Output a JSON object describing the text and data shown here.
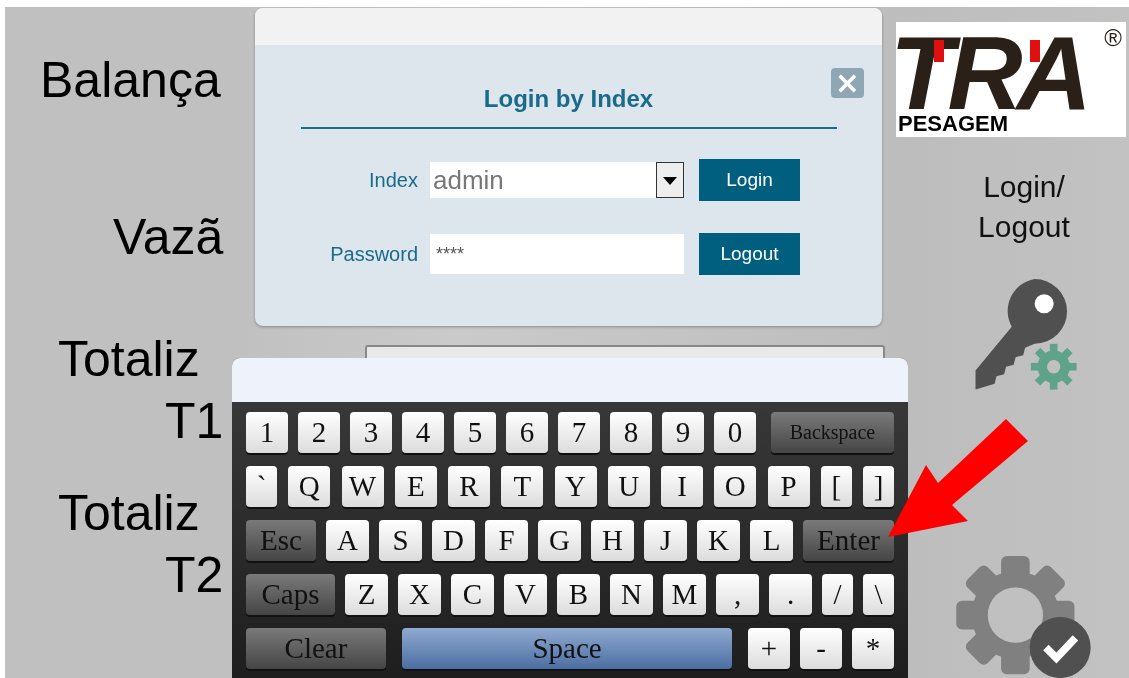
{
  "labels": [
    "Balança",
    "Vazã",
    "Totaliz",
    "T1",
    "Totaliz",
    "T2"
  ],
  "logo": {
    "name": "TRA",
    "mark": "®",
    "tagline": "PESAGEM"
  },
  "login_logout_label": "Login/ Logout",
  "dialog": {
    "title": "Login by Index",
    "close": "×",
    "index_label": "Index",
    "index_value": "admin",
    "password_label": "Password",
    "password_value": "****",
    "buttons": [
      "Login",
      "Logout"
    ]
  },
  "keyboard": {
    "rows": [
      {
        "keys": [
          {
            "label": "1",
            "kind": "char"
          },
          {
            "label": "2",
            "kind": "char"
          },
          {
            "label": "3",
            "kind": "char"
          },
          {
            "label": "4",
            "kind": "char"
          },
          {
            "label": "5",
            "kind": "char"
          },
          {
            "label": "6",
            "kind": "char"
          },
          {
            "label": "7",
            "kind": "char"
          },
          {
            "label": "8",
            "kind": "char"
          },
          {
            "label": "9",
            "kind": "char"
          },
          {
            "label": "0",
            "kind": "char"
          },
          {
            "label": "Backspace",
            "kind": "function"
          }
        ]
      },
      {
        "keys": [
          {
            "label": "`",
            "kind": "symbol"
          },
          {
            "label": "Q",
            "kind": "char"
          },
          {
            "label": "W",
            "kind": "char"
          },
          {
            "label": "E",
            "kind": "char"
          },
          {
            "label": "R",
            "kind": "char"
          },
          {
            "label": "T",
            "kind": "char"
          },
          {
            "label": "Y",
            "kind": "char"
          },
          {
            "label": "U",
            "kind": "char"
          },
          {
            "label": "I",
            "kind": "char"
          },
          {
            "label": "O",
            "kind": "char"
          },
          {
            "label": "P",
            "kind": "char"
          },
          {
            "label": "[",
            "kind": "symbol"
          },
          {
            "label": "]",
            "kind": "symbol"
          }
        ]
      },
      {
        "keys": [
          {
            "label": "Esc",
            "kind": "function"
          },
          {
            "label": "A",
            "kind": "char"
          },
          {
            "label": "S",
            "kind": "char"
          },
          {
            "label": "D",
            "kind": "char"
          },
          {
            "label": "F",
            "kind": "char"
          },
          {
            "label": "G",
            "kind": "char"
          },
          {
            "label": "H",
            "kind": "char"
          },
          {
            "label": "J",
            "kind": "char"
          },
          {
            "label": "K",
            "kind": "char"
          },
          {
            "label": "L",
            "kind": "char"
          },
          {
            "label": "Enter",
            "kind": "function"
          }
        ]
      },
      {
        "keys": [
          {
            "label": "Caps",
            "kind": "function"
          },
          {
            "label": "Z",
            "kind": "char"
          },
          {
            "label": "X",
            "kind": "char"
          },
          {
            "label": "C",
            "kind": "char"
          },
          {
            "label": "V",
            "kind": "char"
          },
          {
            "label": "B",
            "kind": "char"
          },
          {
            "label": "N",
            "kind": "char"
          },
          {
            "label": "M",
            "kind": "char"
          },
          {
            "label": ",",
            "kind": "char"
          },
          {
            "label": ".",
            "kind": "char"
          },
          {
            "label": "/",
            "kind": "symbol"
          },
          {
            "label": "\\",
            "kind": "symbol"
          }
        ]
      },
      {
        "keys": [
          {
            "label": "Clear",
            "kind": "function"
          },
          {
            "label": "Space",
            "kind": "space"
          },
          {
            "label": "+",
            "kind": "char"
          },
          {
            "label": "-",
            "kind": "char"
          },
          {
            "label": "*",
            "kind": "char"
          }
        ]
      }
    ]
  }
}
